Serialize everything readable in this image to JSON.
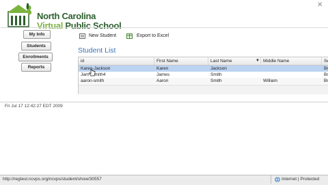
{
  "header": {
    "brand_line1": "North Carolina",
    "brand_line2_a": "Virtual",
    "brand_line2_b": " Public School",
    "colors": {
      "brand_green": "#7bb33f",
      "brand_dark": "#2d5f2e",
      "accent_blue": "#3a72b5"
    }
  },
  "nav": {
    "items": [
      {
        "label": "My Info"
      },
      {
        "label": "Students"
      },
      {
        "label": "Enrollments"
      },
      {
        "label": "Reports"
      }
    ]
  },
  "toolbar": {
    "new_student_label": "New Student",
    "export_label": "Export to Excel"
  },
  "main": {
    "title": "Student List",
    "columns": [
      "id",
      "First Name",
      "Last Name",
      "Middle Name",
      "Se"
    ],
    "rows": [
      {
        "id": "Karen-Jackson",
        "first": "Karen",
        "last": "Jackson",
        "middle": "",
        "extra": "Br",
        "selected": true
      },
      {
        "id": "Jam   -Smith4",
        "first": "James",
        "last": "Smith",
        "middle": "",
        "extra": "Br"
      },
      {
        "id": "aaron-smith",
        "first": "Aaron",
        "last": "Smith",
        "middle": "William",
        "extra": "Br"
      }
    ]
  },
  "footer": {
    "timestamp": "Fri Jul 17 12:42:27 EDT 2009"
  },
  "statusbar": {
    "url": "http://regtest.ncvps.org/ncvps/student/show/30557",
    "zone": "Internet | Protected"
  }
}
